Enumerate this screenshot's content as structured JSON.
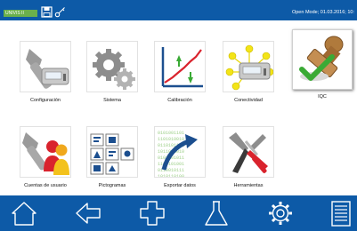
{
  "top_bar": {
    "user_badge": "UNIVIS II",
    "save_icon": "save-icon",
    "key_icon": "key-icon",
    "status_text": "Open Mode; 01.03.2016; 10:"
  },
  "tiles": [
    {
      "label": "Configuración",
      "icon": "wrench-device-icon"
    },
    {
      "label": "Sistema",
      "icon": "gears-icon"
    },
    {
      "label": "Calibración",
      "icon": "calibration-chart-icon"
    },
    {
      "label": "Conectividad",
      "icon": "connectivity-icon"
    },
    {
      "label": "IQC",
      "icon": "stamp-check-icon"
    },
    {
      "label": "Cuentas de usuario",
      "icon": "user-accounts-icon"
    },
    {
      "label": "Pictogramas",
      "icon": "pictograms-icon"
    },
    {
      "label": "Exportar datos",
      "icon": "export-data-icon"
    },
    {
      "label": "Herramientas",
      "icon": "tools-icon"
    }
  ],
  "selected_tile": "IQC",
  "bottom_bar": {
    "buttons": [
      "home-icon",
      "back-icon",
      "plus-icon",
      "flask-icon",
      "settings-icon",
      "list-icon"
    ]
  },
  "colors": {
    "bar": "#0d5aa7",
    "badge": "#6ab04c",
    "accent_green": "#3aaa35"
  }
}
